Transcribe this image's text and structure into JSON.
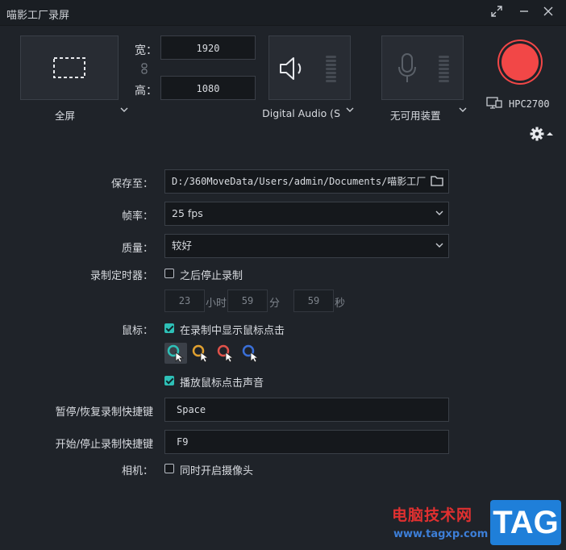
{
  "window": {
    "title": "喵影工厂录屏"
  },
  "capture": {
    "mode_label": "全屏",
    "width_label": "宽：",
    "height_label": "高：",
    "width_value": "1920",
    "height_value": "1080"
  },
  "audio": {
    "device_label": "Digital Audio (S/"
  },
  "mic": {
    "device_label": "无可用装置"
  },
  "monitor": {
    "name": "HPC2700"
  },
  "form": {
    "save_label": "保存至：",
    "save_path": "D:/360MoveData/Users/admin/Documents/喵影工厂",
    "fps_label": "帧率：",
    "fps_value": "25 fps",
    "quality_label": "质量：",
    "quality_value": "较好",
    "timer_label": "录制定时器：",
    "timer_check_label": "之后停止录制",
    "timer_checked": false,
    "timer_hours": "23",
    "timer_hours_unit": "小时",
    "timer_minutes": "59",
    "timer_minutes_unit": "分",
    "timer_seconds": "59",
    "timer_seconds_unit": "秒",
    "mouse_label": "鼠标：",
    "mouse_show_clicks_label": "在录制中显示鼠标点击",
    "mouse_show_clicks_checked": true,
    "mouse_sound_label": "播放鼠标点击声音",
    "mouse_sound_checked": true,
    "cursor_colors": [
      "#2ec0b7",
      "#e0a030",
      "#e0524a",
      "#3a6fd8"
    ],
    "pause_hotkey_label": "暂停/恢复录制快捷键",
    "pause_hotkey_value": "Space",
    "start_hotkey_label": "开始/停止录制快捷键",
    "start_hotkey_value": "F9",
    "camera_label": "相机：",
    "camera_check_label": "同时开启摄像头",
    "camera_checked": false
  },
  "watermark": {
    "site_name": "电脑技术网",
    "site_url": "www.tagxp.com",
    "badge": "TAG"
  },
  "colors": {
    "accent": "#2ec0b7",
    "record": "#f24747",
    "background": "#1f2329"
  }
}
